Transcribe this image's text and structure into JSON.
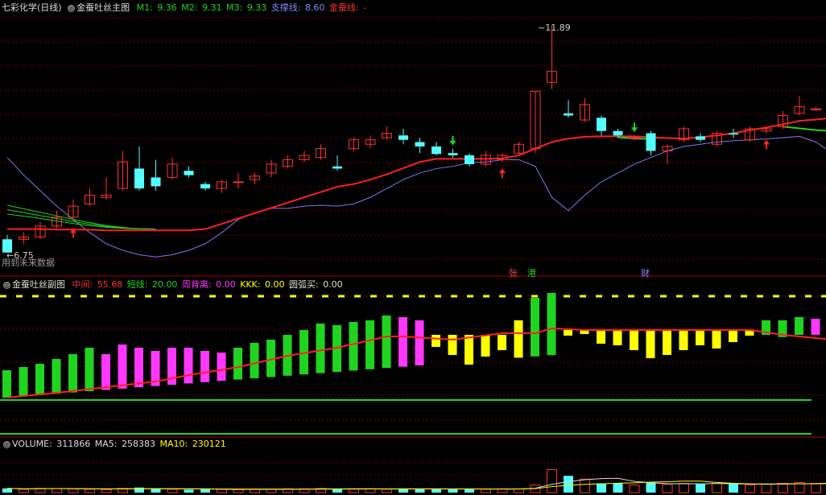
{
  "colors": {
    "up": "#ff3333",
    "down": "#54ffff",
    "ma": "#ff2020",
    "support": "#7b7bf0",
    "green": "#21d321",
    "magenta": "#ff37ff",
    "yellow": "#ffff00",
    "grid": "#780000",
    "white": "#dddddd"
  },
  "main_header": {
    "title": "七彩化学(日线)",
    "indicator": "金蚕吐丝主图",
    "m1_label": "M1: ",
    "m1": "9.36",
    "m2_label": "M2: ",
    "m2": "9.31",
    "m3_label": "M3: ",
    "m3": "9.33",
    "support_label": "支撑线: ",
    "support": "8.60",
    "gold_label": "金蚕线: ",
    "gold": "-"
  },
  "main_annotations": {
    "high": "11.89",
    "low": "6.75",
    "future_data": "用到未来数据",
    "tag_zhang": "张",
    "tag_gang": "港",
    "tag_cai": "财"
  },
  "sub_header": {
    "indicator": "金蚕吐丝副图",
    "mid_label": "中间: ",
    "mid": "55.68",
    "short_label": "短线: ",
    "short": "20.00",
    "zhou_label": "周背离: ",
    "zhou": "0.00",
    "kkk_label": "KKK: ",
    "kkk": "0.00",
    "yuanhu_label": "圆弧买: ",
    "yuanhu": "0.00"
  },
  "vol_header": {
    "vol_label": "VOLUME: ",
    "vol": "311866",
    "ma5_label": "MA5: ",
    "ma5": "258383",
    "ma10_label": "MA10: ",
    "ma10": "230121"
  },
  "chart_data": {
    "type": "candlestick",
    "candles": [
      [
        7.05,
        6.75,
        7.15,
        6.75
      ],
      [
        7.05,
        7.1,
        7.2,
        6.95
      ],
      [
        7.1,
        7.35,
        7.45,
        7.05
      ],
      [
        7.35,
        7.55,
        7.7,
        7.3
      ],
      [
        7.55,
        7.8,
        7.95,
        7.45
      ],
      [
        7.85,
        8.05,
        8.2,
        7.8
      ],
      [
        8.0,
        8.05,
        8.45,
        7.95
      ],
      [
        8.2,
        8.8,
        9.05,
        8.15
      ],
      [
        8.65,
        8.2,
        9.15,
        8.15
      ],
      [
        8.45,
        8.25,
        8.85,
        8.15
      ],
      [
        8.45,
        8.75,
        8.9,
        8.4
      ],
      [
        8.6,
        8.5,
        8.7,
        8.45
      ],
      [
        8.3,
        8.2,
        8.35,
        8.15
      ],
      [
        8.2,
        8.35,
        8.4,
        8.1
      ],
      [
        8.35,
        8.35,
        8.55,
        8.2
      ],
      [
        8.4,
        8.48,
        8.55,
        8.3
      ],
      [
        8.55,
        8.75,
        8.85,
        8.45
      ],
      [
        8.7,
        8.85,
        8.95,
        8.65
      ],
      [
        8.85,
        8.95,
        9.05,
        8.8
      ],
      [
        8.9,
        9.1,
        9.2,
        8.85
      ],
      [
        8.7,
        8.65,
        8.95,
        8.6
      ],
      [
        9.1,
        9.3,
        9.35,
        9.05
      ],
      [
        9.2,
        9.3,
        9.4,
        9.1
      ],
      [
        9.35,
        9.45,
        9.6,
        9.3
      ],
      [
        9.4,
        9.3,
        9.55,
        9.2
      ],
      [
        9.25,
        9.15,
        9.35,
        9.0
      ],
      [
        9.15,
        8.98,
        9.25,
        8.95
      ],
      [
        9.0,
        8.95,
        9.1,
        8.9
      ],
      [
        8.95,
        8.75,
        9.0,
        8.7
      ],
      [
        8.75,
        8.95,
        9.05,
        8.7
      ],
      [
        8.85,
        8.95,
        9.0,
        8.8
      ],
      [
        9.0,
        9.2,
        9.25,
        8.95
      ],
      [
        9.1,
        10.4,
        10.4,
        9.0
      ],
      [
        10.6,
        10.85,
        11.89,
        10.45
      ],
      [
        9.9,
        9.85,
        10.2,
        9.8
      ],
      [
        9.75,
        10.1,
        10.25,
        9.7
      ],
      [
        9.8,
        9.5,
        9.85,
        9.4
      ],
      [
        9.5,
        9.4,
        9.55,
        9.35
      ],
      [
        9.35,
        9.35,
        9.4,
        9.3
      ],
      [
        9.45,
        9.05,
        9.5,
        8.95
      ],
      [
        9.05,
        9.15,
        9.2,
        8.75
      ],
      [
        9.3,
        9.55,
        9.6,
        9.25
      ],
      [
        9.38,
        9.3,
        9.45,
        9.25
      ],
      [
        9.2,
        9.45,
        9.5,
        9.15
      ],
      [
        9.45,
        9.42,
        9.55,
        9.35
      ],
      [
        9.3,
        9.55,
        9.6,
        9.25
      ],
      [
        9.5,
        9.55,
        9.6,
        9.45
      ],
      [
        9.6,
        9.85,
        9.95,
        9.55
      ],
      [
        9.9,
        10.05,
        10.3,
        9.85
      ],
      [
        10.0,
        10.0,
        10.05,
        9.95
      ],
      [
        10.0,
        10.35,
        10.45,
        9.95
      ]
    ],
    "gold_line": [
      7.28,
      7.28,
      7.28,
      7.27,
      7.27,
      7.27,
      7.25,
      7.25,
      7.25,
      7.25,
      7.25,
      7.25,
      7.28,
      7.4,
      7.52,
      7.64,
      7.76,
      7.88,
      8.0,
      8.12,
      8.24,
      8.3,
      8.4,
      8.52,
      8.66,
      8.8,
      8.87,
      8.87,
      8.87,
      8.87,
      8.88,
      8.95,
      9.1,
      9.25,
      9.33,
      9.37,
      9.38,
      9.38,
      9.38,
      9.36,
      9.34,
      9.33,
      9.36,
      9.4,
      9.45,
      9.52,
      9.58,
      9.65,
      9.73,
      9.76,
      9.8
    ],
    "support_line": [
      8.9,
      8.5,
      8.15,
      7.8,
      7.5,
      7.2,
      6.95,
      6.8,
      6.7,
      6.65,
      6.7,
      6.8,
      6.95,
      7.2,
      7.5,
      7.65,
      7.75,
      7.75,
      7.8,
      7.82,
      7.8,
      7.85,
      8.0,
      8.2,
      8.4,
      8.55,
      8.65,
      8.7,
      8.78,
      8.8,
      8.85,
      8.85,
      8.7,
      8.0,
      7.7,
      8.05,
      8.35,
      8.55,
      8.75,
      8.9,
      9.05,
      9.15,
      9.2,
      9.25,
      9.28,
      9.3,
      9.32,
      9.35,
      9.38,
      9.25,
      9.0
    ],
    "green_lines": [
      [
        7.82,
        7.7,
        7.58,
        7.46,
        7.36,
        7.3,
        7.28
      ],
      [
        7.72,
        7.62,
        7.52,
        7.42,
        7.34,
        7.3,
        7.28
      ],
      [
        7.62,
        7.55,
        7.46,
        7.38,
        7.32,
        7.29,
        7.28
      ]
    ],
    "ylim": [
      6.6,
      12.1
    ],
    "sub_bars": [
      [
        -94,
        -91,
        "green"
      ],
      [
        -91,
        -88,
        "green"
      ],
      [
        -88,
        -85,
        "green"
      ],
      [
        -85,
        -82,
        "green"
      ],
      [
        -82,
        -79,
        "green"
      ],
      [
        -79,
        -76,
        "green"
      ],
      [
        -76,
        -74,
        "magenta"
      ],
      [
        -74,
        -72,
        "magenta"
      ],
      [
        -72,
        -70,
        "magenta"
      ],
      [
        -70,
        -68,
        "magenta"
      ],
      [
        -68,
        -66,
        "magenta"
      ],
      [
        -66,
        -63,
        "magenta"
      ],
      [
        -63,
        -60,
        "magenta"
      ],
      [
        -60,
        -57,
        "magenta"
      ],
      [
        -57,
        -53,
        "green"
      ],
      [
        -53,
        -50,
        "green"
      ],
      [
        -50,
        -47,
        "green"
      ],
      [
        -47,
        -44,
        "green"
      ],
      [
        -44,
        -41,
        "green"
      ],
      [
        -41,
        -38,
        "green"
      ],
      [
        -38,
        -35,
        "green"
      ],
      [
        -35,
        -32,
        "green"
      ],
      [
        -32,
        -30,
        "green"
      ],
      [
        -30,
        -28,
        "green"
      ],
      [
        -28,
        -26,
        "magenta"
      ],
      [
        -26,
        -24,
        "magenta"
      ],
      [
        -24,
        -22,
        "yellow"
      ],
      [
        -22,
        -20,
        "yellow"
      ],
      [
        -20,
        -18,
        "yellow"
      ],
      [
        -18,
        -16,
        "yellow"
      ],
      [
        -16,
        -14,
        "yellow"
      ],
      [
        -14,
        -12,
        "yellow"
      ],
      [
        -12,
        -10,
        "green"
      ],
      [
        -10,
        -8,
        "green"
      ],
      [
        -8,
        -6,
        "yellow"
      ],
      [
        -6,
        -4,
        "magenta"
      ],
      [
        -4,
        -4,
        "yellow"
      ],
      [
        -4,
        -4,
        "yellow"
      ],
      [
        -4,
        -4,
        "yellow"
      ],
      [
        -4,
        -4,
        "yellow"
      ],
      [
        -4,
        -4,
        "yellow"
      ],
      [
        -4,
        -4,
        "yellow"
      ],
      [
        -4,
        -4,
        "yellow"
      ],
      [
        -4,
        -4,
        "yellow"
      ],
      [
        -4,
        -4,
        "yellow"
      ],
      [
        -4,
        -4,
        "yellow"
      ],
      [
        -4,
        -4,
        "yellow"
      ],
      [
        -4,
        -4,
        "green"
      ],
      [
        -4,
        -4,
        "green"
      ],
      [
        -4,
        -4,
        "magenta"
      ],
      [
        -4,
        -4,
        "green"
      ]
    ],
    "volumes": [
      0.1,
      0.08,
      0.1,
      0.1,
      0.09,
      0.08,
      0.07,
      0.1,
      0.12,
      0.09,
      0.08,
      0.07,
      0.08,
      0.08,
      0.07,
      0.08,
      0.08,
      0.09,
      0.09,
      0.1,
      0.09,
      0.09,
      0.09,
      0.08,
      0.09,
      0.09,
      0.09,
      0.08,
      0.08,
      0.08,
      0.09,
      0.09,
      0.18,
      0.55,
      0.4,
      0.32,
      0.22,
      0.22,
      0.18,
      0.24,
      0.2,
      0.22,
      0.2,
      0.22,
      0.2,
      0.18,
      0.2,
      0.22,
      0.24,
      0.22,
      0.28
    ],
    "signals": {
      "up_arrows": [
        4,
        30,
        46
      ],
      "down_arrows": [
        27,
        38
      ]
    }
  }
}
